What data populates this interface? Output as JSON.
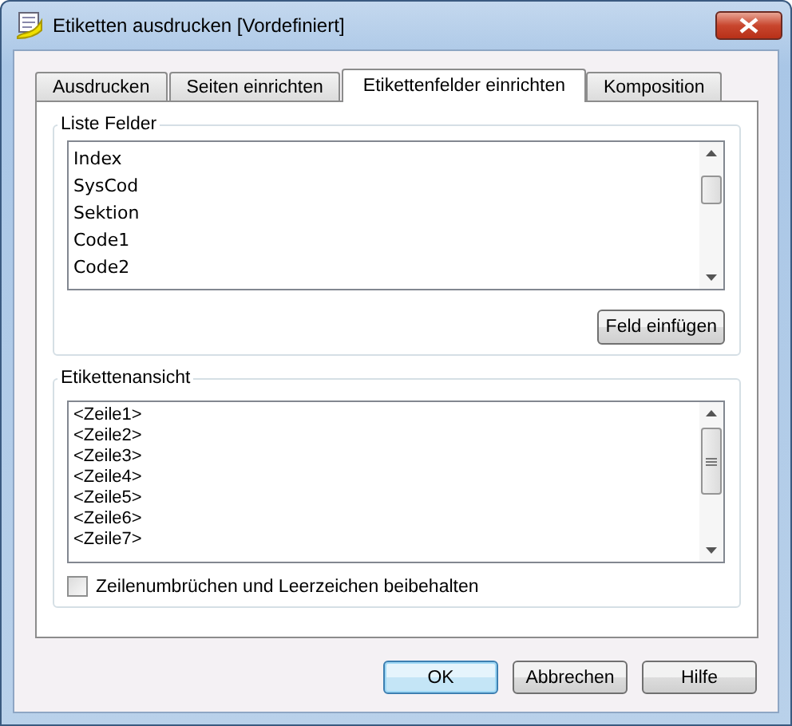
{
  "window": {
    "title": "Etiketten ausdrucken [Vordefiniert]"
  },
  "tabs": [
    {
      "label": "Ausdrucken",
      "selected": false
    },
    {
      "label": "Seiten einrichten",
      "selected": false
    },
    {
      "label": "Etikettenfelder einrichten",
      "selected": true
    },
    {
      "label": "Komposition",
      "selected": false
    }
  ],
  "fields_group": {
    "title": "Liste Felder",
    "items": [
      "Index",
      "SysCod",
      "Sektion",
      "Code1",
      "Code2"
    ],
    "button": "Feld einfügen"
  },
  "preview_group": {
    "title": "Etikettenansicht",
    "lines": [
      "<Zeile1>",
      "<Zeile2>",
      "<Zeile3>",
      "<Zeile4>",
      "<Zeile5>",
      "<Zeile6>",
      "<Zeile7>"
    ],
    "checkbox": {
      "label": "Zeilenumbrüchen und Leerzeichen beibehalten",
      "checked": false
    }
  },
  "buttons": [
    {
      "label": "OK",
      "kind": "default"
    },
    {
      "label": "Abbrechen",
      "kind": "normal"
    },
    {
      "label": "Hilfe",
      "kind": "normal"
    }
  ]
}
